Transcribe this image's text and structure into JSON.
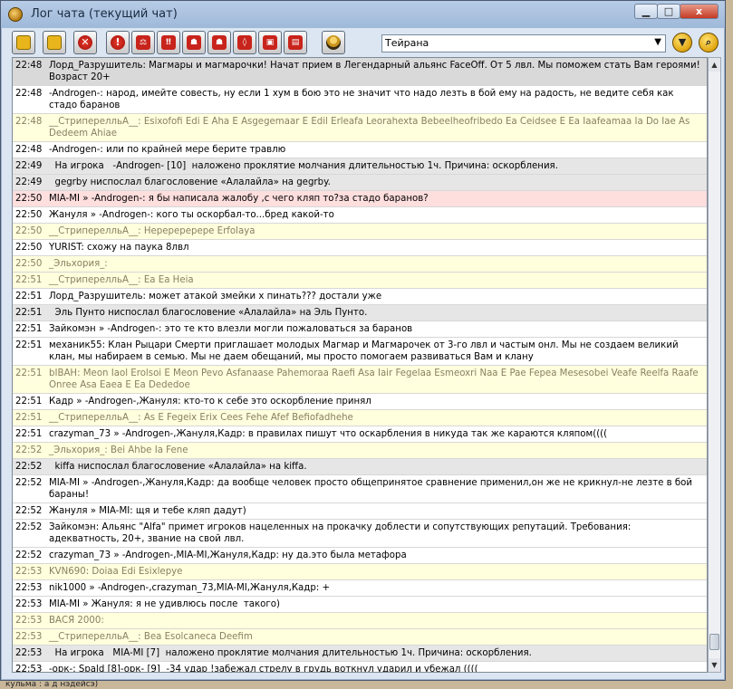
{
  "window": {
    "title": "Лог чата (текущий чат)",
    "close_label": "x"
  },
  "toolbar": {
    "buttons": [
      {
        "icon": "document-icon",
        "glyph": ""
      },
      {
        "icon": "lock-icon",
        "glyph": ""
      },
      {
        "icon": "cancel-icon",
        "glyph": "✕"
      },
      {
        "icon": "alert-icon",
        "glyph": "!"
      },
      {
        "icon": "scales-icon",
        "glyph": "⚖"
      },
      {
        "icon": "double-alert-icon",
        "glyph": "‼"
      },
      {
        "icon": "group-icon",
        "glyph": "☗"
      },
      {
        "icon": "crowd-icon",
        "glyph": "☗"
      },
      {
        "icon": "shield-icon",
        "glyph": "◊"
      },
      {
        "icon": "card-icon",
        "glyph": "▣"
      },
      {
        "icon": "card-alt-icon",
        "glyph": "▤"
      },
      {
        "icon": "user-icon",
        "glyph": ""
      }
    ],
    "channel_value": "Тейрана",
    "filter_icon": "filter-icon",
    "search_icon": "search-icon"
  },
  "messages": [
    {
      "time": "22:48",
      "text": "Лорд_Разрушитель: Магмары и магмарочки! Начат прием в Легендарный альянс FaceOff. От 5 лвл. Мы поможем стать Вам героями! Возраст 20+",
      "style": "h"
    },
    {
      "time": "22:48",
      "text": "-Androgen-: народ, имейте совесть, ну если 1 хум в бою это не значит что надо лезть в бой ему на радость, не ведите себя как стадо баранов",
      "style": ""
    },
    {
      "time": "22:48",
      "text": "__СтриперелльА__: Esixofofi Edi E Aha E Asgegemaar E Edil Erleafa Leorahexta Bebeelheofribedo Ea Ceidsee E Ea Iaafeamaa Ia Do Iae As Dedeem Ahiae",
      "style": "y"
    },
    {
      "time": "22:48",
      "text": "-Androgen-: или по крайней мере берите травлю",
      "style": ""
    },
    {
      "time": "22:49",
      "text": "  На игрока   -Androgen- [10]  наложено проклятие молчания длительностью 1ч. Причина: оскорбления.",
      "style": "g"
    },
    {
      "time": "22:49",
      "text": "  gegrby ниспослал благословение «Алалайла» на gegrby.",
      "style": "g"
    },
    {
      "time": "22:50",
      "text": "MIA-MI » -Androgen-: я бы написала жалобу ,с чего кляп то?за стадо баранов?",
      "style": "p"
    },
    {
      "time": "22:50",
      "text": "Жануля » -Androgen-: кого ты оскорбал-то...бред какой-то",
      "style": ""
    },
    {
      "time": "22:50",
      "text": "__СтриперелльА__: Неререререре Erfolaya",
      "style": "y"
    },
    {
      "time": "22:50",
      "text": "YURIST: схожу на паука 8лвл",
      "style": ""
    },
    {
      "time": "22:50",
      "text": "_Эльхория_:",
      "style": "y"
    },
    {
      "time": "22:51",
      "text": "__СтриперелльА__: Ea Ea Heia",
      "style": "y"
    },
    {
      "time": "22:51",
      "text": "Лорд_Разрушитель: может атакой змейки х пинать??? достали уже",
      "style": ""
    },
    {
      "time": "22:51",
      "text": "  Эль Пунто ниспослал благословение «Алалайла» на Эль Пунто.",
      "style": "g"
    },
    {
      "time": "22:51",
      "text": "Зайкомэн » -Androgen-: это те кто влезли могли пожаловаться за баранов",
      "style": ""
    },
    {
      "time": "22:51",
      "text": "механик55: Клан Рыцари Смерти приглашает молодых Магмар и Магмарочек от 3-го лвл и частым онл. Мы не создаем великий клан, мы набираем в семью. Мы не даем обещаний, мы просто помогаем развиваться Вам и клану",
      "style": ""
    },
    {
      "time": "22:51",
      "text": "bIBAH: Meon Iaol Erolsoi E Meon Pevo Asfanaase Pahemoraa Raefi Asa Iair Fegelaa Esmeoxri Naa E Pae Fepea Mesesobei Veafe Reelfa Raafe Onree Asa Eaea E Ea Dededoe",
      "style": "y"
    },
    {
      "time": "22:51",
      "text": "Кадр » -Androgen-,Жануля: кто-то к себе это оскорбление принял",
      "style": ""
    },
    {
      "time": "22:51",
      "text": "__СтриперелльА__: As E Fegeix Erix Cees Fehe Afef Befiofadhehe",
      "style": "y"
    },
    {
      "time": "22:51",
      "text": "crazyman_73 » -Androgen-,Жануля,Кадр: в правилах пишут что оскарбления в никуда так же караются кляпом((((",
      "style": ""
    },
    {
      "time": "22:52",
      "text": "_Эльхория_: Bei Ahbe Ia Fene",
      "style": "y"
    },
    {
      "time": "22:52",
      "text": "  kiffa ниспослал благословение «Алалайла» на kiffa.",
      "style": "g"
    },
    {
      "time": "22:52",
      "text": "MIA-MI » -Androgen-,Жануля,Кадр: да вообще человек просто общепринятое сравнение применил,он же не крикнул-не лезте в бой бараны!",
      "style": ""
    },
    {
      "time": "22:52",
      "text": "Жануля » MIA-MI: щя и тебе кляп дадут)",
      "style": ""
    },
    {
      "time": "22:52",
      "text": "Зайкомэн: Альянс \"Alfa\" примет игроков нацеленных на прокачку доблести и сопутствующих репутаций. Требования: адекватность, 20+, звание на свой лвл.",
      "style": ""
    },
    {
      "time": "22:52",
      "text": "crazyman_73 » -Androgen-,MIA-MI,Жануля,Кадр: ну да.это была метафора",
      "style": ""
    },
    {
      "time": "22:53",
      "text": "KVN690: Doiaa Edi Esixlepye",
      "style": "y"
    },
    {
      "time": "22:53",
      "text": "nik1000 » -Androgen-,crazyman_73,MIA-MI,Жануля,Кадр: +",
      "style": ""
    },
    {
      "time": "22:53",
      "text": "MIA-MI » Жануля: я не удивлюсь после  такого)",
      "style": ""
    },
    {
      "time": "22:53",
      "text": "ВАСЯ 2000:",
      "style": "y"
    },
    {
      "time": "22:53",
      "text": "__СтриперелльА__: Bea Esolcaneca Deefim",
      "style": "y"
    },
    {
      "time": "22:53",
      "text": "  На игрока   MIA-MI [7]  наложено проклятие молчания длительностью 1ч. Причина: оскорбления.",
      "style": "g"
    },
    {
      "time": "22:53",
      "text": "-орк-: Spald [8]-орк- [9]  -34 удар !забежал стрелу в грудь воткнул ударил и убежал ((((",
      "style": ""
    }
  ],
  "bottom_text": "кульма : а д нэдейсэ)"
}
